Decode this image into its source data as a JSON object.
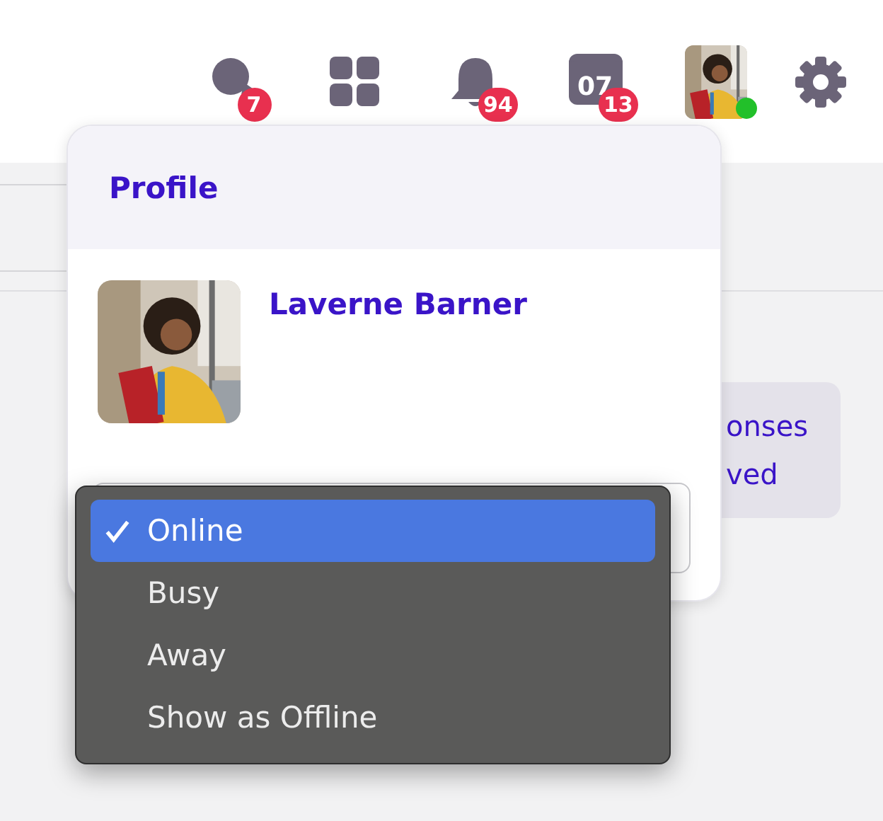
{
  "header": {
    "icons": [
      {
        "kind": "chat",
        "badge": "7"
      },
      {
        "kind": "apps"
      },
      {
        "kind": "bell",
        "badge": "94"
      },
      {
        "kind": "calendar",
        "date": "07",
        "badge": "13"
      },
      {
        "kind": "avatar",
        "online": true
      },
      {
        "kind": "settings"
      }
    ]
  },
  "background_card": {
    "lines": [
      "onses",
      "ved"
    ]
  },
  "profile_popover": {
    "title": "Profile",
    "name": "Laverne Barner"
  },
  "status_menu": {
    "items": [
      {
        "label": "Online",
        "selected": true
      },
      {
        "label": "Busy",
        "selected": false
      },
      {
        "label": "Away",
        "selected": false
      },
      {
        "label": "Show as Offline",
        "selected": false
      }
    ]
  }
}
